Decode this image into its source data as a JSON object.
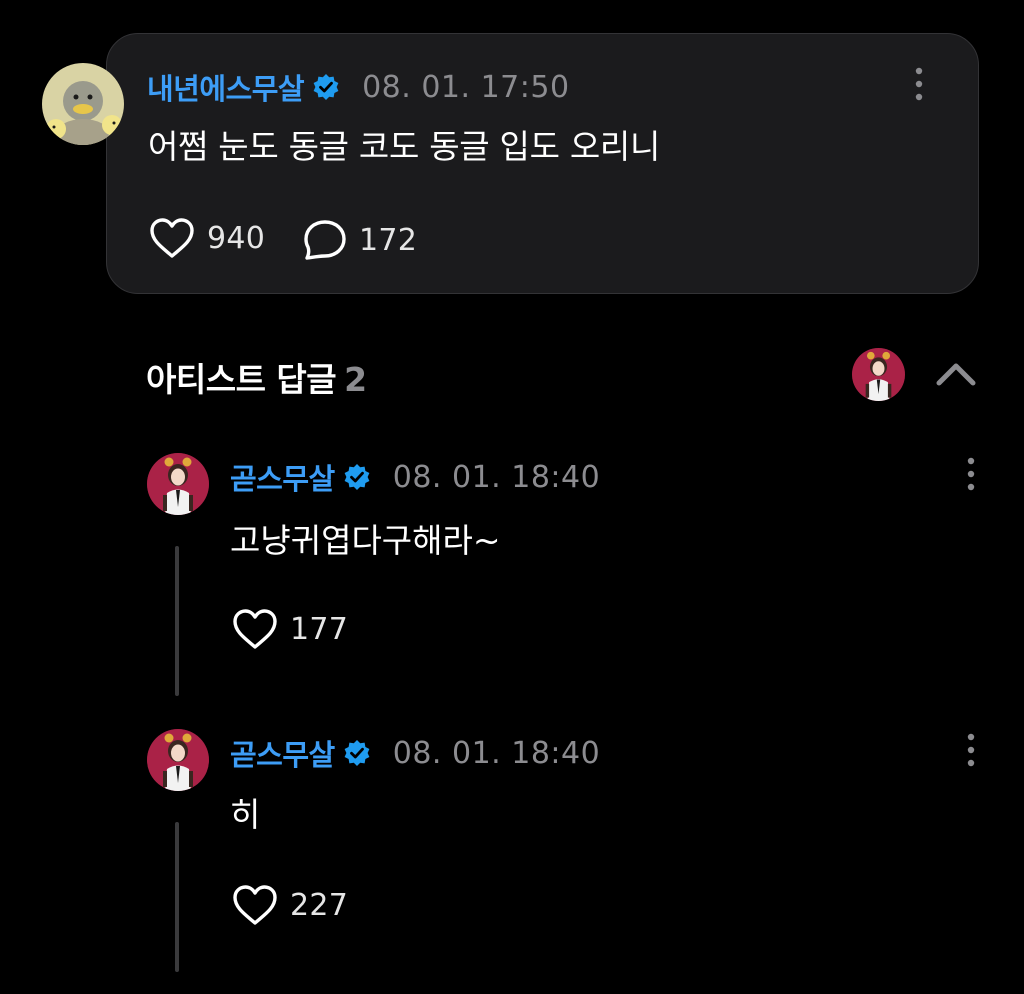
{
  "post": {
    "username": "내년에스무살",
    "verified_icon": "verified-badge-icon",
    "timestamp": "08. 01. 17:50",
    "text": "어쩜 눈도 동글 코도 동글 입도 오리니",
    "likes": "940",
    "comments": "172"
  },
  "artist_replies": {
    "title": "아티스트 답글",
    "count": "2",
    "replies": [
      {
        "username": "곧스무살",
        "timestamp": "08. 01. 18:40",
        "text": "고냥귀엽다구해라~",
        "likes": "177"
      },
      {
        "username": "곧스무살",
        "timestamp": "08. 01. 18:40",
        "text": "히",
        "likes": "227"
      }
    ]
  },
  "colors": {
    "background": "#000000",
    "card": "#1b1b1d",
    "username": "#3d9df6",
    "verified": "#1f9cf0",
    "muted": "#8c8c90",
    "thread_line": "#3a3a3c"
  }
}
